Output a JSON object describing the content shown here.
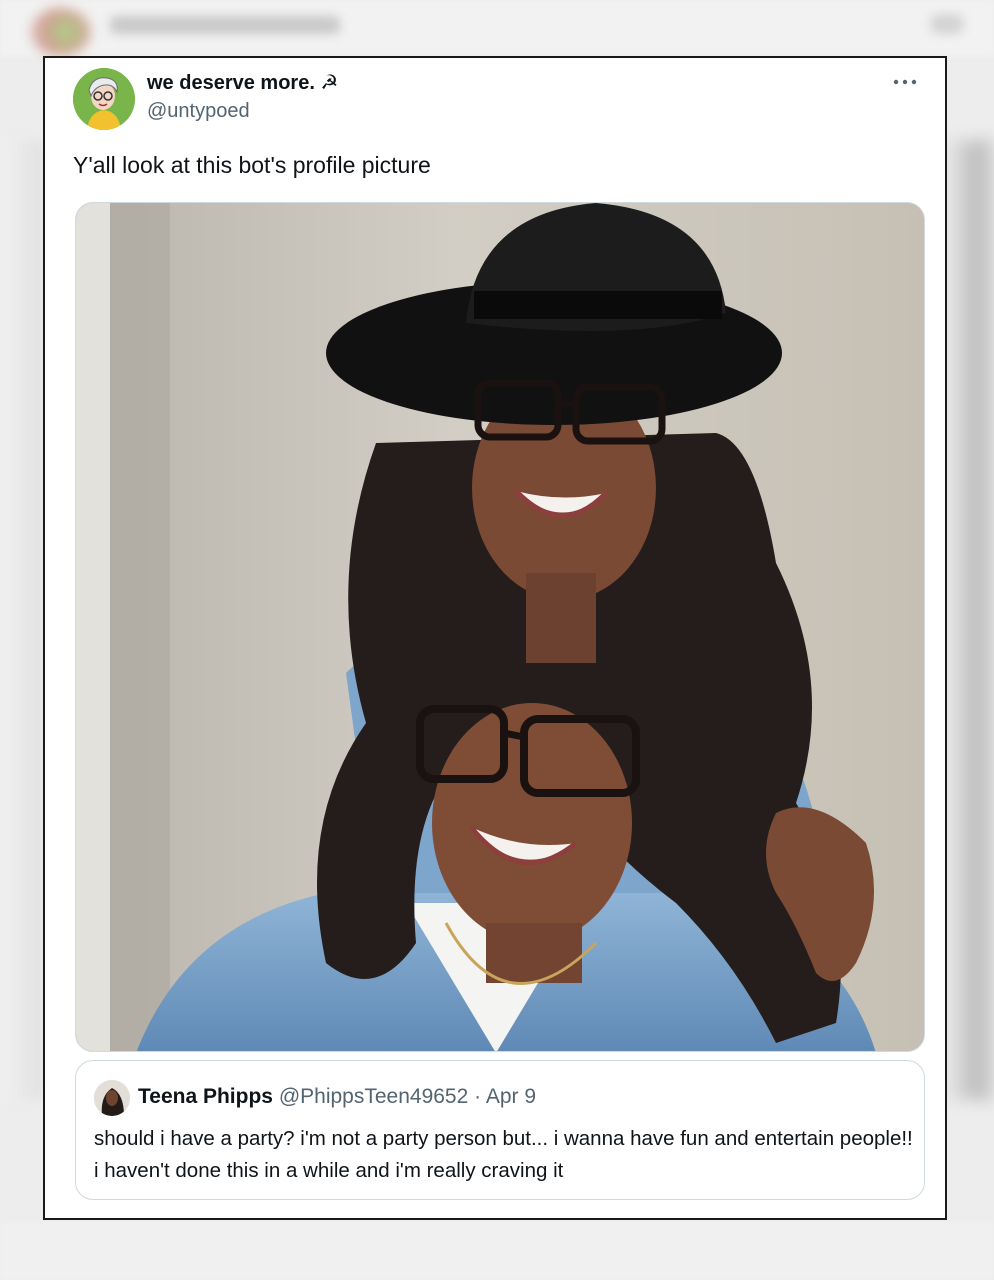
{
  "tweet": {
    "display_name": "we deserve more. ☭",
    "handle": "@untypoed",
    "text": "Y'all look at this bot's profile picture",
    "more_icon": "more-horizontal-icon"
  },
  "media": {
    "kind": "photo",
    "subject": "ai-generated-profile-photo"
  },
  "quote": {
    "display_name": "Teena Phipps",
    "handle": "@PhippsTeen49652",
    "separator": "·",
    "date": "Apr 9",
    "text": "should i have a party? i'm not a party person but... i wanna have fun and entertain people!! i haven't done this in a while and i'm really craving it"
  },
  "colors": {
    "text_primary": "#0f1419",
    "text_secondary": "#536471",
    "border": "#cfd9de",
    "card_outline": "#1a1a1a"
  }
}
